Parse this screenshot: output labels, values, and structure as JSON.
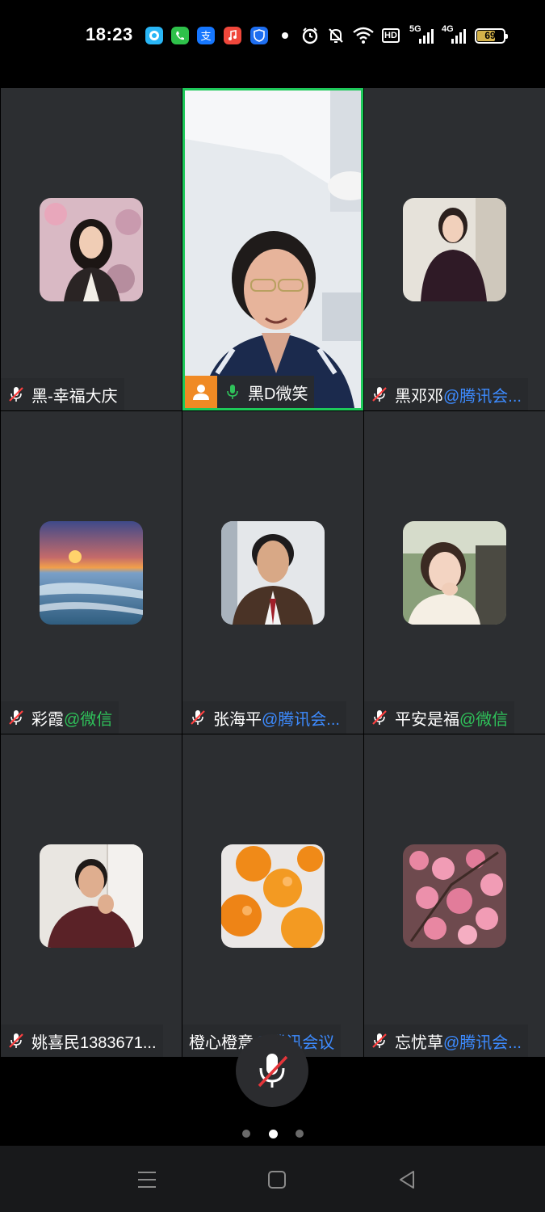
{
  "status_bar": {
    "time": "18:23",
    "network_labels": [
      "HD",
      "5G",
      "4G"
    ],
    "battery": "69",
    "icons": [
      "chat-app-icon",
      "phone-app-icon",
      "alipay-app-icon",
      "music-app-icon",
      "shield-app-icon",
      "notification-dot-icon",
      "alarm-icon",
      "mute-icon",
      "wifi-icon",
      "hd-icon",
      "signal-5g-icon",
      "signal-4g-icon",
      "battery-icon"
    ]
  },
  "participants": [
    {
      "name": "黑-幸福大庆",
      "source": "",
      "source_color": "",
      "mic": "muted"
    },
    {
      "name": "黑D微笑",
      "source": "",
      "source_color": "",
      "mic": "active",
      "video": true
    },
    {
      "name": "黑邓邓",
      "source": "@腾讯会...",
      "source_color": "blue",
      "mic": "muted"
    },
    {
      "name": "彩霞",
      "source": "@微信",
      "source_color": "green",
      "mic": "muted"
    },
    {
      "name": "张海平",
      "source": "@腾讯会...",
      "source_color": "blue",
      "mic": "muted"
    },
    {
      "name": "平安是福",
      "source": "@微信",
      "source_color": "green",
      "mic": "muted"
    },
    {
      "name": "姚喜民1383671...",
      "source": "",
      "source_color": "",
      "mic": "muted"
    },
    {
      "name": "橙心橙意",
      "source": "@腾讯会议",
      "source_color": "blue",
      "mic": "none"
    },
    {
      "name": "忘忧草",
      "source": "@腾讯会...",
      "source_color": "blue",
      "mic": "muted"
    }
  ],
  "controls": {
    "mic_state": "muted",
    "page_count": 3,
    "current_page": 2
  },
  "nav": {
    "buttons": [
      "recents-icon",
      "home-icon",
      "back-icon"
    ]
  }
}
